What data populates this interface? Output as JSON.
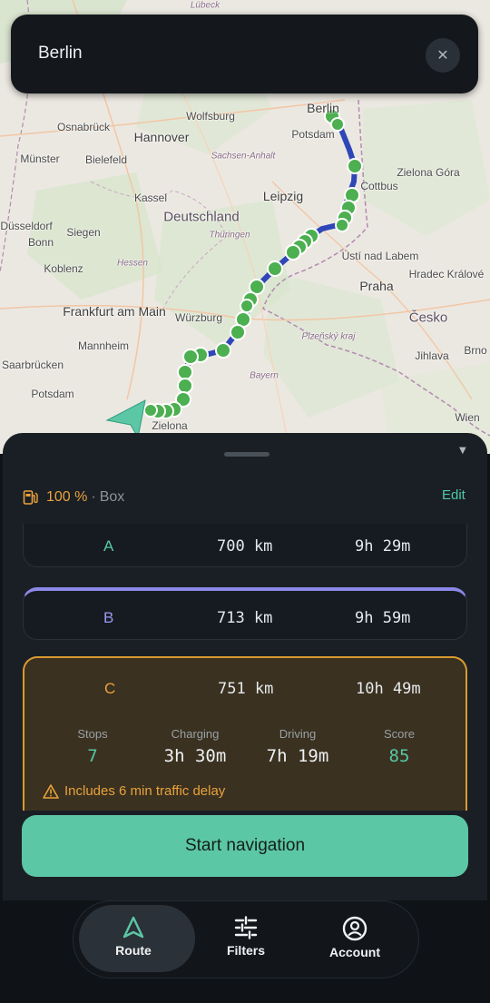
{
  "map": {
    "labels": [
      {
        "text": "Lübeck",
        "cls": "small"
      },
      {
        "text": "Berlin",
        "cls": ""
      },
      {
        "text": "Potsdam",
        "cls": ""
      },
      {
        "text": "Wolfsburg",
        "cls": ""
      },
      {
        "text": "Osnabrück",
        "cls": ""
      },
      {
        "text": "Hannover",
        "cls": "big"
      },
      {
        "text": "Münster",
        "cls": ""
      },
      {
        "text": "Bielefeld",
        "cls": ""
      },
      {
        "text": "Sachsen-Anhalt",
        "cls": "small"
      },
      {
        "text": "Cottbus",
        "cls": ""
      },
      {
        "text": "Zielona Góra",
        "cls": ""
      },
      {
        "text": "Kassel",
        "cls": ""
      },
      {
        "text": "Leipzig",
        "cls": "big"
      },
      {
        "text": "Düsseldorf",
        "cls": ""
      },
      {
        "text": "Deutschland",
        "cls": "country"
      },
      {
        "text": "Bonn",
        "cls": ""
      },
      {
        "text": "Siegen",
        "cls": ""
      },
      {
        "text": "Thüringen",
        "cls": "small"
      },
      {
        "text": "Ústí nad Labem",
        "cls": ""
      },
      {
        "text": "Koblenz",
        "cls": ""
      },
      {
        "text": "Hessen",
        "cls": "small"
      },
      {
        "text": "Praha",
        "cls": "big"
      },
      {
        "text": "Hradec Králové",
        "cls": ""
      },
      {
        "text": "Frankfurt am Main",
        "cls": "big"
      },
      {
        "text": "Würzburg",
        "cls": ""
      },
      {
        "text": "Česko",
        "cls": "country"
      },
      {
        "text": "Mannheim",
        "cls": ""
      },
      {
        "text": "Plzeňský kraj",
        "cls": "small"
      },
      {
        "text": "Saarbrücken",
        "cls": ""
      },
      {
        "text": "Jihlava",
        "cls": ""
      },
      {
        "text": "Brno",
        "cls": ""
      },
      {
        "text": "Potsdam",
        "cls": ""
      },
      {
        "text": "Bayern",
        "cls": "small"
      },
      {
        "text": "Wien",
        "cls": ""
      },
      {
        "text": "Zielona",
        "cls": ""
      }
    ]
  },
  "search": {
    "query": "Berlin",
    "clear_icon": "close-icon"
  },
  "sheet": {
    "battery_pct": "100 %",
    "separator": "·",
    "vehicle": "Box",
    "edit_label": "Edit",
    "routes": [
      {
        "name": "A",
        "distance": "700 km",
        "duration": "9h 29m"
      },
      {
        "name": "B",
        "distance": "713 km",
        "duration": "9h 59m"
      },
      {
        "name": "C",
        "distance": "751 km",
        "duration": "10h 49m"
      }
    ],
    "selected": {
      "stops_label": "Stops",
      "stops": "7",
      "charging_label": "Charging",
      "charging": "3h 30m",
      "driving_label": "Driving",
      "driving": "7h 19m",
      "score_label": "Score",
      "score": "85",
      "traffic_warning": "Includes 6 min traffic delay"
    },
    "start_label": "Start navigation"
  },
  "nav": {
    "items": [
      {
        "label": "Route",
        "icon": "navigation-arrow-icon"
      },
      {
        "label": "Filters",
        "icon": "sliders-icon"
      },
      {
        "label": "Account",
        "icon": "account-icon"
      }
    ]
  },
  "colors": {
    "accent_green": "#5cc7a5",
    "route_a": "#56c8a4",
    "route_b": "#9b98f0",
    "route_c": "#e9a23b",
    "route_line": "#2f46b8",
    "stop_marker": "#4caf50"
  }
}
